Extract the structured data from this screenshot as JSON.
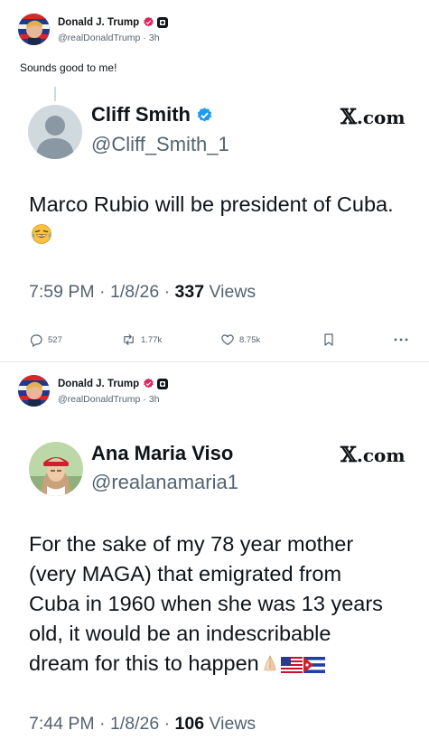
{
  "posts": [
    {
      "author": {
        "name": "Donald J. Trump",
        "handle": "@realDonaldTrump",
        "time": "3h"
      },
      "text": "Sounds good to me!",
      "quote": {
        "name": "Cliff Smith",
        "handle": "@Cliff_Smith_1",
        "source": ".com",
        "body": "Marco Rubio will be president of Cuba.",
        "time": "7:59 PM",
        "date": "1/8/26",
        "views_count": "337",
        "views_label": "Views"
      },
      "actions": {
        "replies": "527",
        "reposts": "1.77k",
        "likes": "8.75k"
      }
    },
    {
      "author": {
        "name": "Donald J. Trump",
        "handle": "@realDonaldTrump",
        "time": "3h"
      },
      "quote": {
        "name": "Ana Maria Viso",
        "handle": "@realanamaria1",
        "source": ".com",
        "body_lines": [
          "For the sake of my 78 year mother",
          "(very MAGA) that emigrated from",
          "Cuba in 1960 when she was 13 years",
          "old, it would be an indescribable",
          "dream for this to happen"
        ],
        "time": "7:44 PM",
        "date": "1/8/26",
        "views_count": "106",
        "views_label": "Views"
      }
    }
  ],
  "icons": {
    "verified": "verified-badge-icon",
    "affiliate": "affiliate-badge-icon",
    "reply": "reply-icon",
    "repost": "repost-icon",
    "like": "heart-icon",
    "bookmark": "bookmark-icon",
    "more": "more-icon"
  },
  "colors": {
    "verified_pink": "#e0245e",
    "verified_blue": "#1d9bf0",
    "secondary_text": "#536471",
    "primary_text": "#0f1419"
  }
}
